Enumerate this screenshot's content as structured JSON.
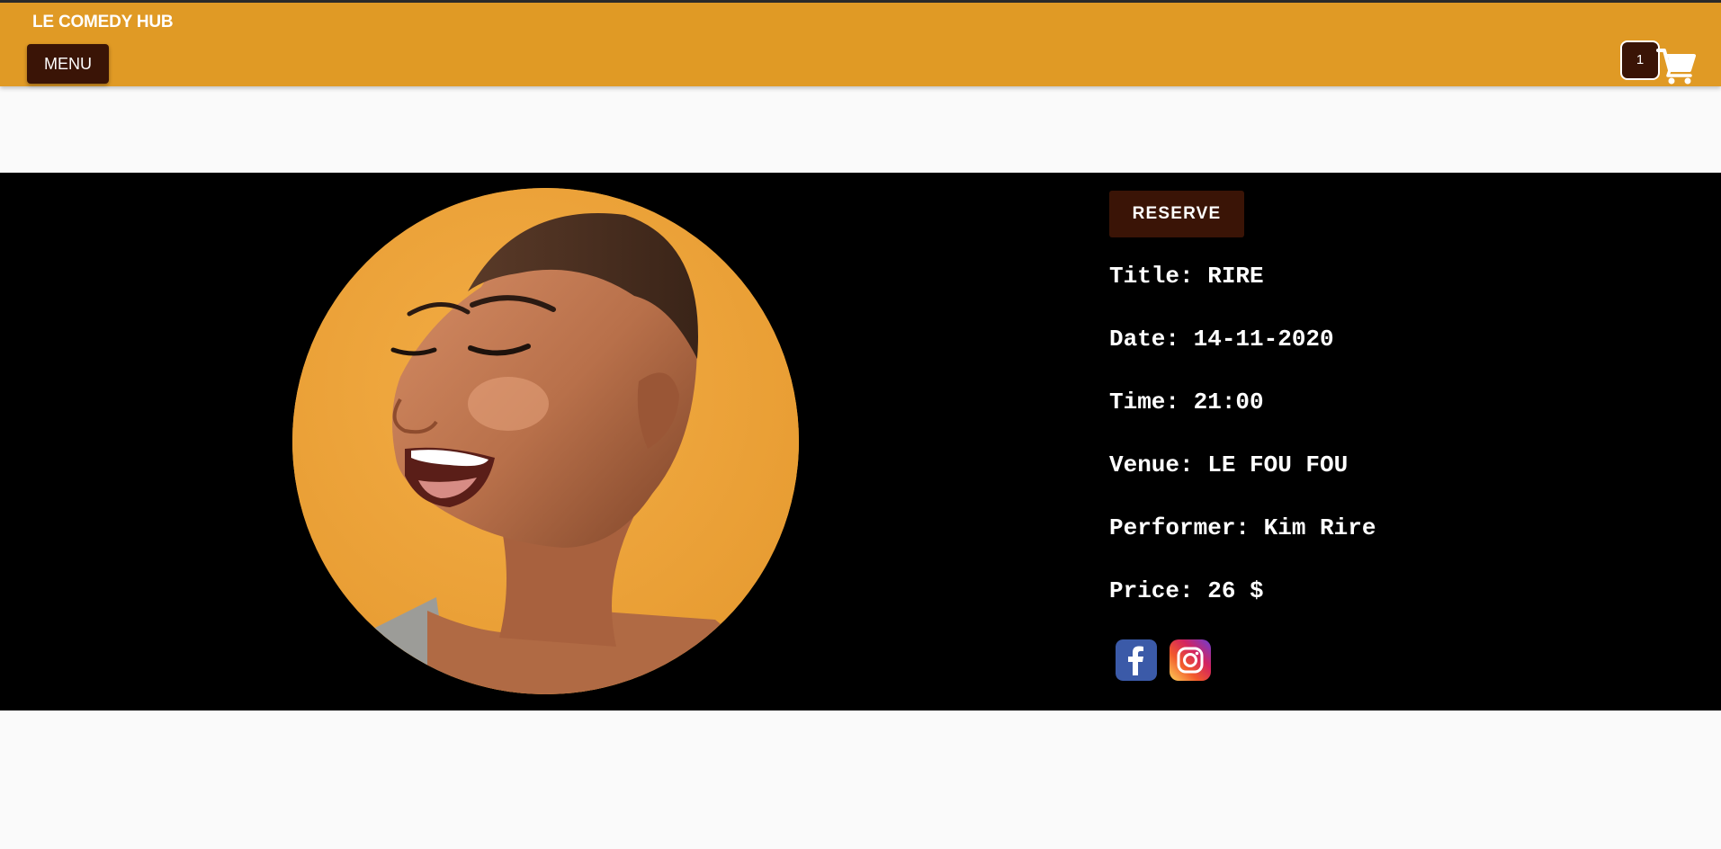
{
  "header": {
    "brand": "LE COMEDY HUB",
    "menu_label": "MENU",
    "cart_count": "1",
    "cart_icon": "cart-icon",
    "background": "#e09a25",
    "button_color": "#3a1406"
  },
  "show": {
    "reserve_label": "RESERVE",
    "title_line": "Title: RIRE",
    "date_line": "Date: 14-11-2020",
    "time_line": "Time: 21:00",
    "venue_line": "Venue: LE FOU FOU",
    "performer_line": "Performer: Kim Rire",
    "price_line": "Price: 26 $",
    "social_icons": [
      "facebook-icon",
      "instagram-icon"
    ]
  }
}
